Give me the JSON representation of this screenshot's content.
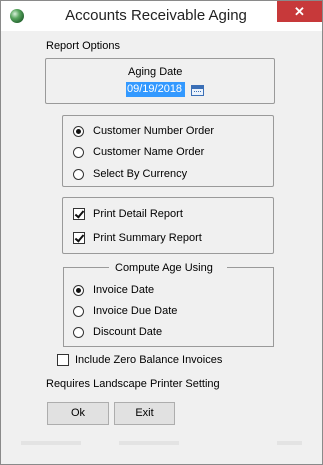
{
  "window": {
    "title": "Accounts Receivable Aging",
    "close_glyph": "✕"
  },
  "report_options": {
    "label": "Report Options",
    "aging_date_label": "Aging Date",
    "aging_date_value": "09/19/2018"
  },
  "order_options": [
    {
      "label": "Customer Number Order",
      "selected": true
    },
    {
      "label": "Customer Name Order",
      "selected": false
    },
    {
      "label": "Select By Currency",
      "selected": false
    }
  ],
  "print_options": [
    {
      "label": "Print Detail Report",
      "checked": true
    },
    {
      "label": "Print Summary Report",
      "checked": true
    }
  ],
  "compute_age": {
    "legend": "Compute Age Using",
    "options": [
      {
        "label": "Invoice Date",
        "selected": true
      },
      {
        "label": "Invoice Due Date",
        "selected": false
      },
      {
        "label": "Discount Date",
        "selected": false
      }
    ]
  },
  "include_zero": {
    "label": "Include Zero Balance Invoices",
    "checked": false
  },
  "note": "Requires Landscape Printer Setting",
  "buttons": {
    "ok": "Ok",
    "exit": "Exit"
  },
  "colors": {
    "accent": "#3399ff",
    "close": "#c7393a"
  },
  "icons": {
    "app": "app-globe-icon",
    "calendar": "calendar-icon",
    "close": "close-icon"
  }
}
